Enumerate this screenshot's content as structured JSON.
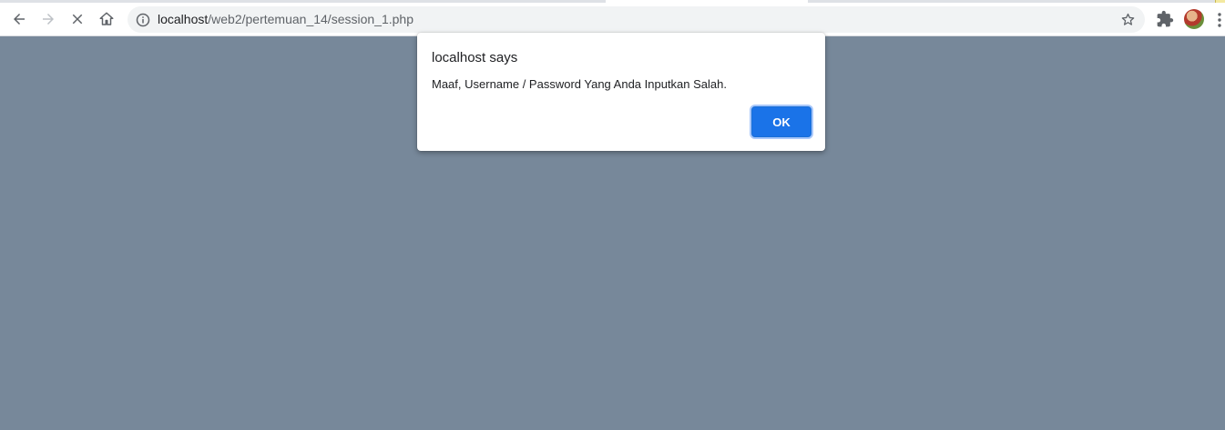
{
  "browser": {
    "url_host": "localhost",
    "url_path": "/web2/pertemuan_14/session_1.php",
    "icons": {
      "back": "back-arrow-icon",
      "forward": "forward-arrow-icon",
      "stop": "stop-loading-icon",
      "home": "home-icon",
      "site_info": "info-icon",
      "bookmark": "star-icon",
      "extensions": "puzzle-icon",
      "menu": "kebab-menu-icon"
    }
  },
  "dialog": {
    "title": "localhost says",
    "message": "Maaf, Username / Password Yang Anda Inputkan Salah.",
    "ok_label": "OK"
  },
  "colors": {
    "page_overlay": "#77889a",
    "accent": "#1a73e8"
  }
}
